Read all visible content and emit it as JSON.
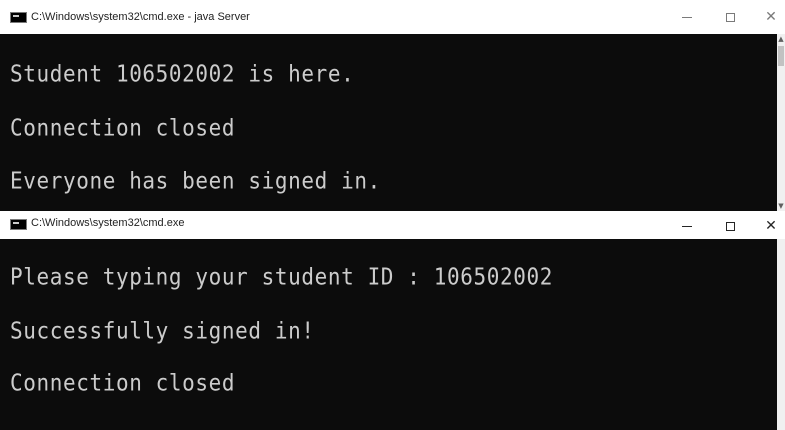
{
  "top_window": {
    "title": "C:\\Windows\\system32\\cmd.exe - java  Server",
    "lines": [
      "Student 106502002 is here.",
      "Connection closed",
      "Everyone has been signed in."
    ]
  },
  "bottom_window": {
    "title": "C:\\Windows\\system32\\cmd.exe",
    "lines": [
      "Please typing your student ID : 106502002",
      "Successfully signed in!",
      "Connection closed"
    ]
  },
  "controls": {
    "minimize_icon": "minimize-icon",
    "maximize_icon": "maximize-icon",
    "close_icon": "close-icon",
    "close_glyph": "✕"
  },
  "colors": {
    "console_bg": "#0c0c0c",
    "console_text": "#cccccc",
    "titlebar_bg": "#ffffff"
  }
}
